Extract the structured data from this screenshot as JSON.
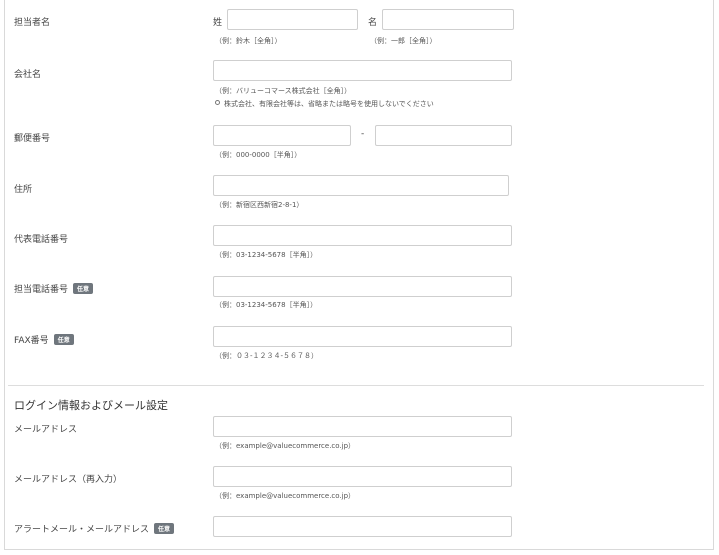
{
  "contact_name": {
    "label": "担当者名",
    "last_label": "姓",
    "first_label": "名",
    "last_value": "",
    "first_value": "",
    "last_hint": "（例：鈴木［全角］）",
    "first_hint": "（例：一郎［全角］）"
  },
  "company": {
    "label": "会社名",
    "value": "",
    "hint": "（例：バリューコマース株式会社［全角］）",
    "note": "株式会社、有限会社等は、省略または略号を使用しないでください"
  },
  "postal": {
    "label": "郵便番号",
    "value1": "",
    "value2": "",
    "separator": "-",
    "hint": "（例：000-0000［半角］）"
  },
  "address": {
    "label": "住所",
    "value": "",
    "hint": "（例：新宿区西新宿2-8-1）"
  },
  "main_phone": {
    "label": "代表電話番号",
    "value": "",
    "hint": "（例：03-1234-5678［半角］）"
  },
  "contact_phone": {
    "label": "担当電話番号",
    "badge": "任意",
    "value": "",
    "hint": "（例：03-1234-5678［半角］）"
  },
  "fax": {
    "label": "FAX番号",
    "badge": "任意",
    "value": "",
    "hint": "（例：０３-１２３４-５６７８）"
  },
  "login_section": {
    "title": "ログイン情報およびメール設定"
  },
  "email": {
    "label": "メールアドレス",
    "value": "",
    "hint": "（例：example@valuecommerce.co.jp）"
  },
  "email_confirm": {
    "label": "メールアドレス（再入力）",
    "value": "",
    "hint": "（例：example@valuecommerce.co.jp）"
  },
  "alert_email": {
    "label": "アラートメール・メールアドレス",
    "badge": "任意",
    "value": ""
  },
  "colors": {
    "badge_bg": "#6f767d",
    "input_border": "#cfcfcf",
    "divider": "#dddddd"
  }
}
